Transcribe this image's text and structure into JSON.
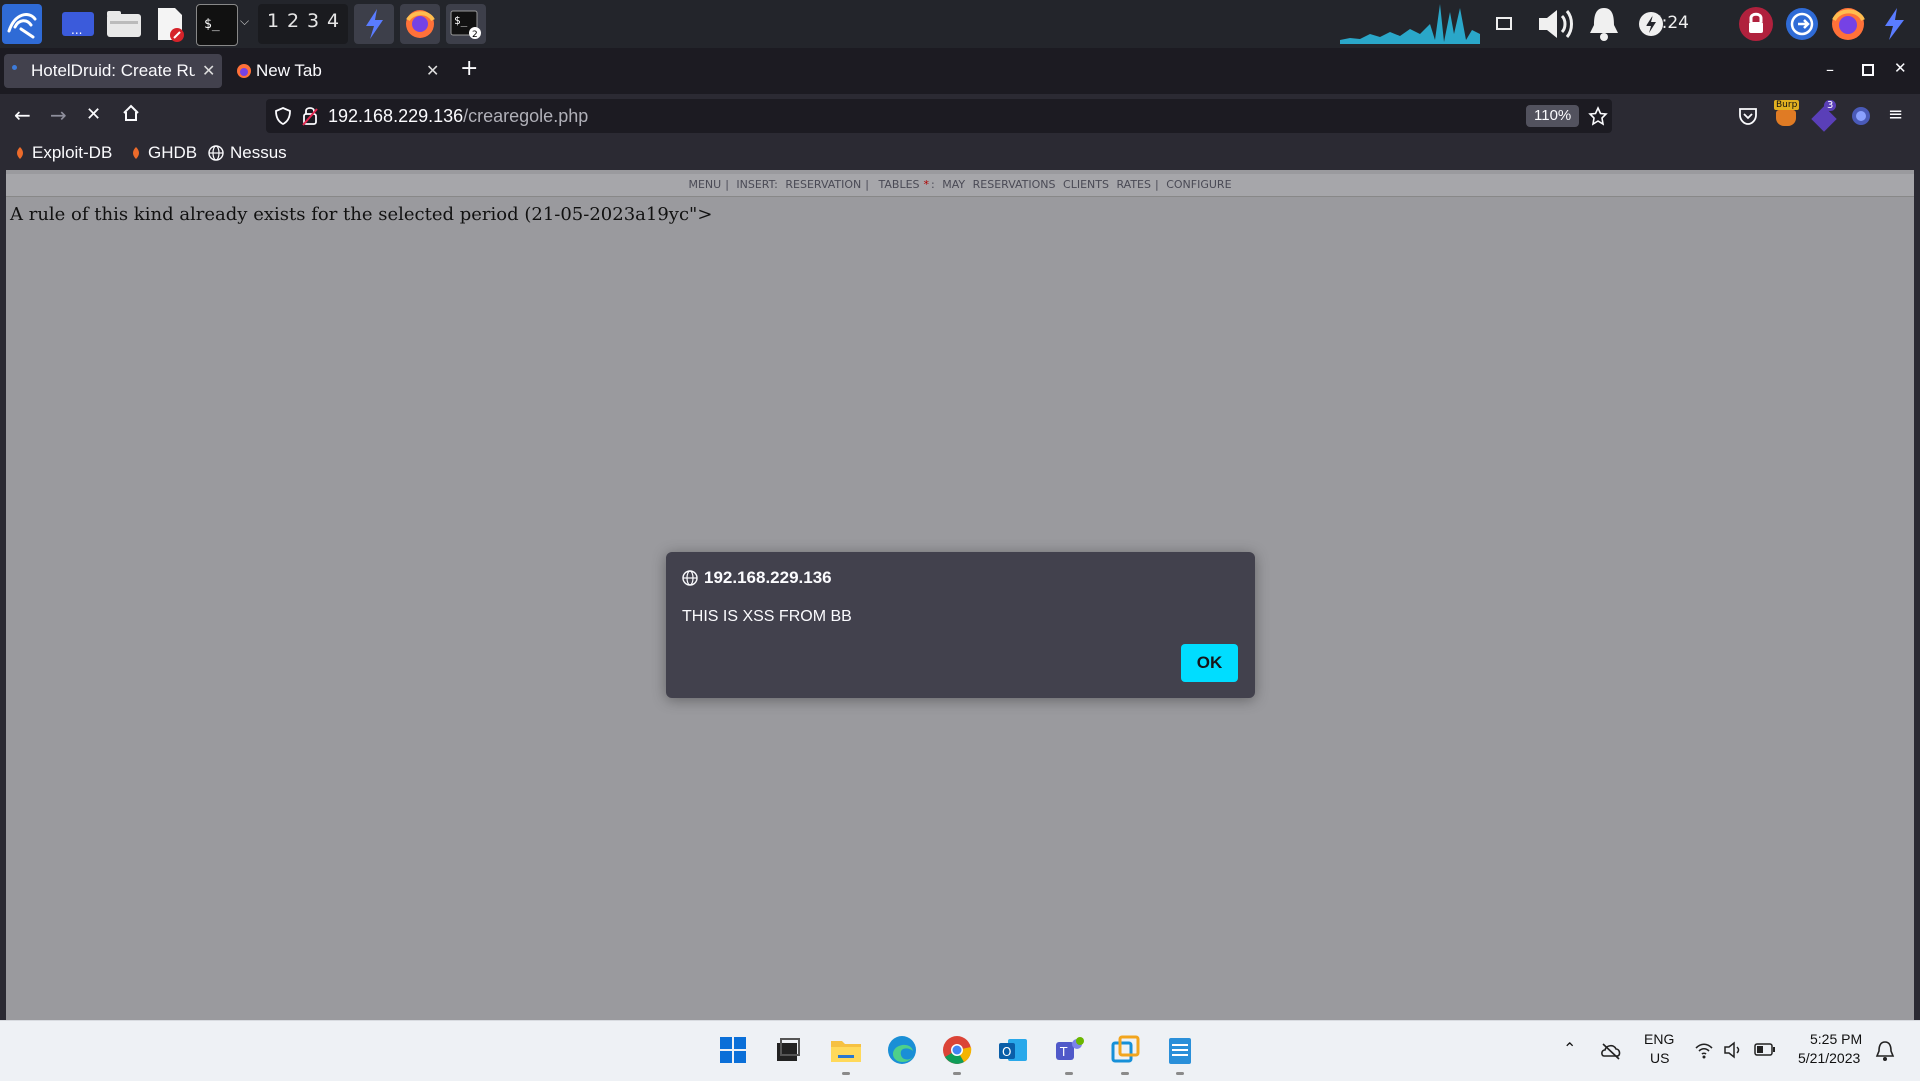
{
  "kali_panel": {
    "workspaces": [
      "1",
      "2",
      "3",
      "4"
    ],
    "clock": "17:24"
  },
  "browser": {
    "tabs": [
      {
        "title": "HotelDruid: Create Ru",
        "active": true
      },
      {
        "title": "New Tab",
        "active": false
      }
    ],
    "url_host": "192.168.229.136",
    "url_path": "/crearegole.php",
    "zoom": "110%",
    "bookmarks": [
      "Exploit-DB",
      "GHDB",
      "Nessus"
    ],
    "extension_badge": "3",
    "burp_label": "Burp"
  },
  "page": {
    "menu": {
      "menu": "MENU",
      "insert": "INSERT:",
      "reservation": "RESERVATION",
      "tables": "TABLES",
      "tables_marker": "*",
      "month": "MAY",
      "reservations": "RESERVATIONS",
      "clients": "CLIENTS",
      "rates": "RATES",
      "configure": "CONFIGURE"
    },
    "error_message": "A rule of this kind already exists for the selected period (21-05-2023a19yc\">"
  },
  "alert": {
    "origin": "192.168.229.136",
    "message": "THIS IS XSS FROM BB",
    "ok_label": "OK"
  },
  "taskbar": {
    "language": "ENG",
    "region": "US",
    "time": "5:25 PM",
    "date": "5/21/2023"
  },
  "colors": {
    "alert_button": "#00ddff",
    "page_overlay": "#9a9a9e",
    "tab_active": "#42414d"
  }
}
